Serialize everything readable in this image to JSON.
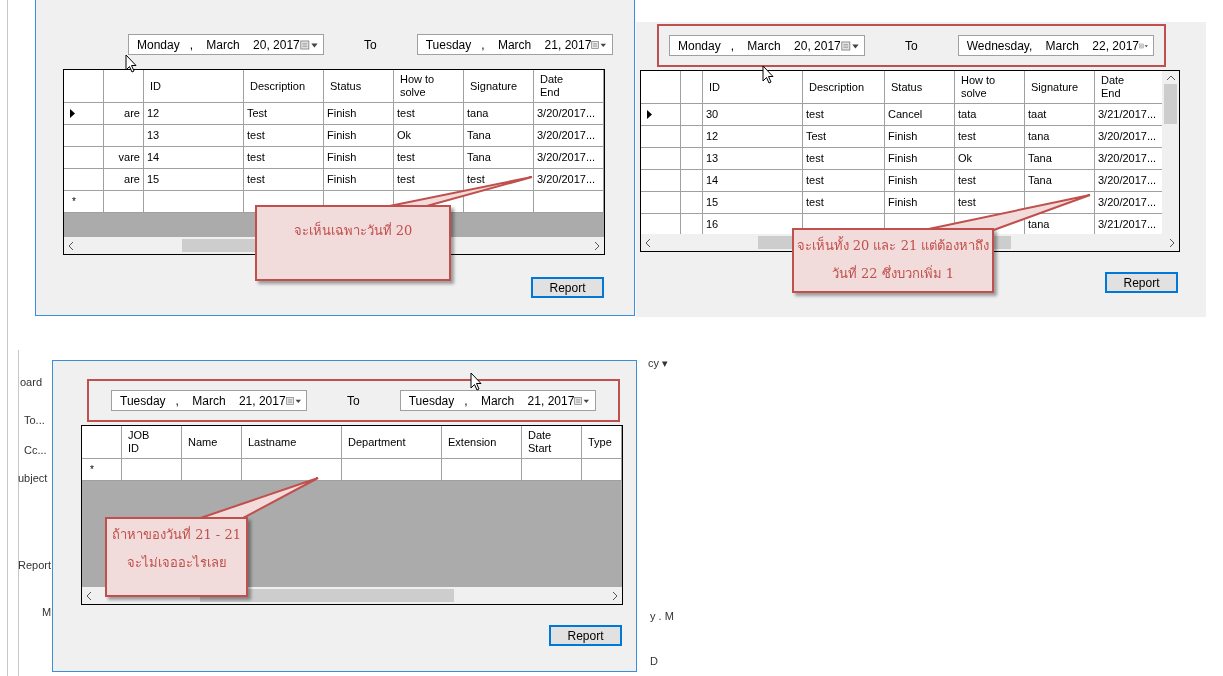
{
  "background_labels": [
    "oard",
    "To...",
    "Cc...",
    "ubject",
    "Report",
    "M",
    "cy ▾",
    "y . M",
    "D"
  ],
  "panels": [
    {
      "highlighted": false,
      "from": "Monday   ,    March    20, 2017",
      "to_label": "To",
      "to": "Tuesday   ,    March    21, 2017",
      "columns": [
        "",
        "ID",
        "Description",
        "Status",
        "How to\nsolve",
        "Signature",
        "Date\nEnd"
      ],
      "rows": [
        {
          "selected": true,
          "cells": [
            "are",
            "12",
            "Test",
            "Finish",
            "test",
            "tana",
            "3/20/2017..."
          ]
        },
        {
          "selected": false,
          "cells": [
            null,
            "13",
            "test",
            "Finish",
            "Ok",
            "Tana",
            "3/20/2017..."
          ]
        },
        {
          "selected": false,
          "cells": [
            "vare",
            "14",
            "test",
            "Finish",
            "test",
            "Tana",
            "3/20/2017..."
          ]
        },
        {
          "selected": false,
          "cells": [
            "are",
            "15",
            "test",
            "Finish",
            "test",
            "test",
            "3/20/2017..."
          ]
        }
      ],
      "new_row_marker": "*",
      "button": "Report",
      "callout": "จะเห็นเฉพาะวันที่ 20"
    },
    {
      "highlighted": true,
      "from": "Monday   ,    March    20, 2017",
      "to_label": "To",
      "to": "Wednesday,    March    22, 2017",
      "columns": [
        "",
        "ID",
        "Description",
        "Status",
        "How to\nsolve",
        "Signature",
        "Date\nEnd"
      ],
      "rows": [
        {
          "selected": true,
          "cells": [
            null,
            "30",
            "test",
            "Cancel",
            "tata",
            "taat",
            "3/21/2017..."
          ]
        },
        {
          "selected": false,
          "cells": [
            null,
            "12",
            "Test",
            "Finish",
            "test",
            "tana",
            "3/20/2017..."
          ]
        },
        {
          "selected": false,
          "cells": [
            null,
            "13",
            "test",
            "Finish",
            "Ok",
            "Tana",
            "3/20/2017..."
          ]
        },
        {
          "selected": false,
          "cells": [
            null,
            "14",
            "test",
            "Finish",
            "test",
            "Tana",
            "3/20/2017..."
          ]
        },
        {
          "selected": false,
          "cells": [
            null,
            "15",
            "test",
            "Finish",
            "test",
            null,
            "3/20/2017..."
          ]
        },
        {
          "selected": false,
          "cells": [
            null,
            "16",
            null,
            null,
            null,
            "tana",
            "3/21/2017..."
          ]
        }
      ],
      "button": "Report",
      "callout": "จะเห็นทั้ง 20 และ 21 แต่ต้องหาถึงวันที่ 22 ซึ่งบวกเพิ่ม 1"
    },
    {
      "highlighted": true,
      "from": "Tuesday   ,    March    21, 2017",
      "to_label": "To",
      "to": "Tuesday   ,    March    21, 2017",
      "columns": [
        "JOB\nID",
        "Name",
        "Lastname",
        "Department",
        "Extension",
        "Date\nStart",
        "Type"
      ],
      "new_row_marker": "*",
      "button": "Report",
      "callout": "ถ้าหาของวันที่ 21 - 21 จะไม่เจออะไรเลย"
    }
  ]
}
